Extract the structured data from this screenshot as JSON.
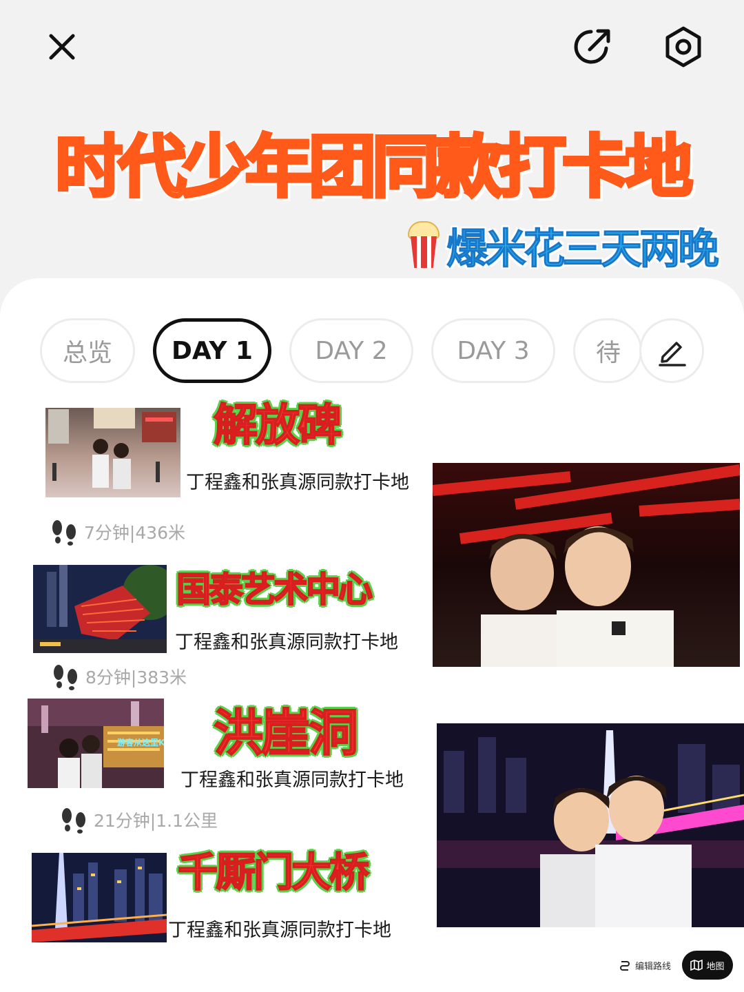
{
  "header": {
    "close_icon": "close-icon",
    "share_icon": "share-icon",
    "settings_icon": "settings-icon"
  },
  "hero": {
    "title": "时代少年团同款打卡地",
    "subtitle": "爆米花三天两晚",
    "subtitle_icon": "popcorn-icon"
  },
  "tabs": {
    "overview": "总览",
    "day1": "DAY 1",
    "day2": "DAY 2",
    "day3": "DAY 3",
    "pending": "待",
    "edit_icon": "pencil-icon",
    "active": "DAY 1"
  },
  "itinerary": [
    {
      "name": "解放碑",
      "desc": "丁程鑫和张真源同款打卡地"
    },
    {
      "name": "国泰艺术中心",
      "desc": "丁程鑫和张真源同款打卡地"
    },
    {
      "name": "洪崖洞",
      "desc": "丁程鑫和张真源同款打卡地"
    },
    {
      "name": "千厮门大桥",
      "desc": "丁程鑫和张真源同款打卡地"
    }
  ],
  "walks": [
    {
      "text": "7分钟|436米"
    },
    {
      "text": "8分钟|383米"
    },
    {
      "text": "21分钟|1.1公里"
    }
  ],
  "thumb_overlay_text": "游客从这里K",
  "bottom": {
    "edit_route": "编辑路线",
    "map": "地图"
  },
  "colors": {
    "accent_dark": "#111111",
    "title_fill": "#fff7b8",
    "title_stroke": "#ff5a1a",
    "subtitle_blue": "#2aa7ea",
    "place_red": "#ff3b2f",
    "place_green_outline": "#5ad14a"
  }
}
